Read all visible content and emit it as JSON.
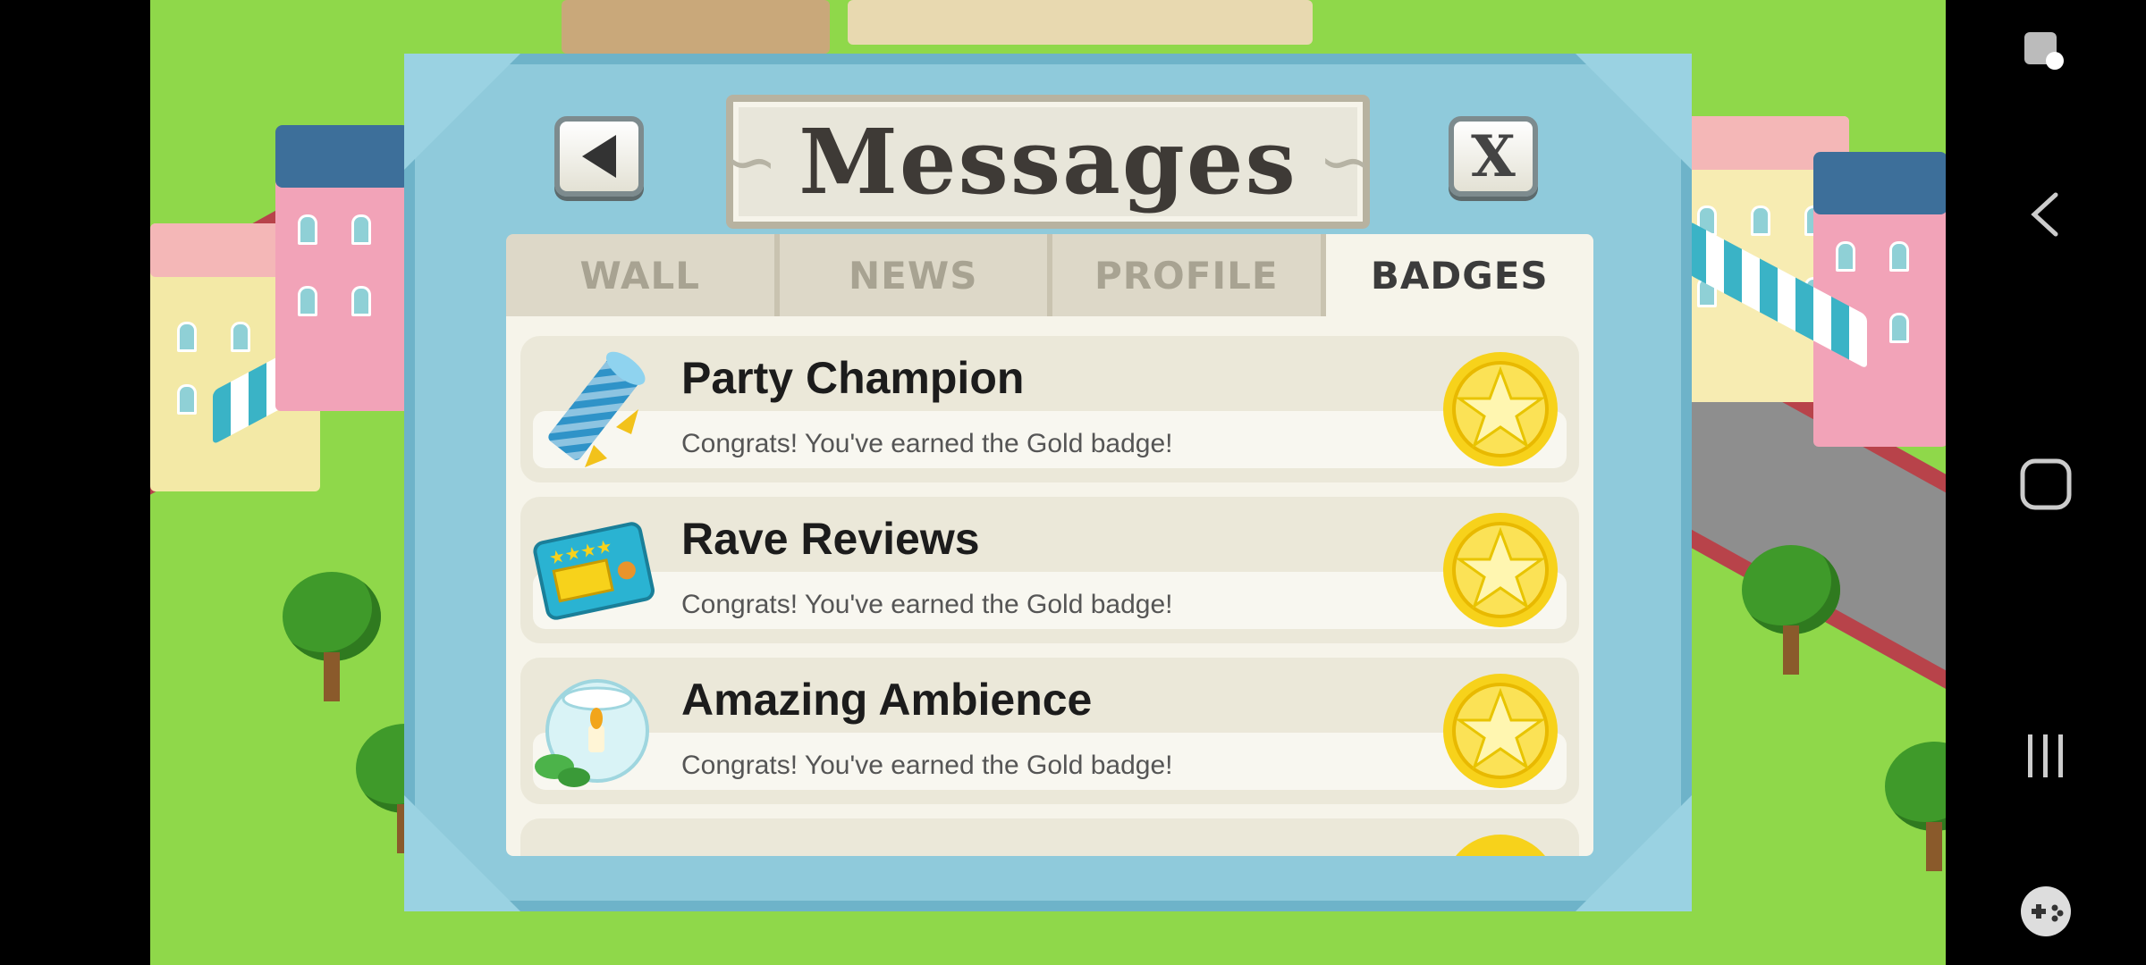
{
  "dialog": {
    "title": "Messages",
    "back_icon": "back-arrow-icon",
    "close_label": "X"
  },
  "tabs": [
    {
      "label": "WALL",
      "active": false
    },
    {
      "label": "NEWS",
      "active": false
    },
    {
      "label": "PROFILE",
      "active": false
    },
    {
      "label": "BADGES",
      "active": true
    }
  ],
  "badges": [
    {
      "name": "Party Champion",
      "description": "Congrats! You've earned the Gold badge!",
      "icon": "party-horn-icon",
      "level": "gold"
    },
    {
      "name": "Rave Reviews",
      "description": "Congrats! You've earned the Gold badge!",
      "icon": "review-card-icon",
      "level": "gold"
    },
    {
      "name": "Amazing Ambience",
      "description": "Congrats! You've earned the Gold badge!",
      "icon": "candle-bowl-icon",
      "level": "gold"
    }
  ],
  "colors": {
    "frame": "#6eb3c9",
    "frame_light": "#8fcadb",
    "panel": "#f6f4ea",
    "gold": "#f7d21b"
  },
  "system_nav": {
    "icons": [
      "screen-record-icon",
      "back-icon",
      "home-icon",
      "recents-icon",
      "game-controller-icon"
    ]
  }
}
